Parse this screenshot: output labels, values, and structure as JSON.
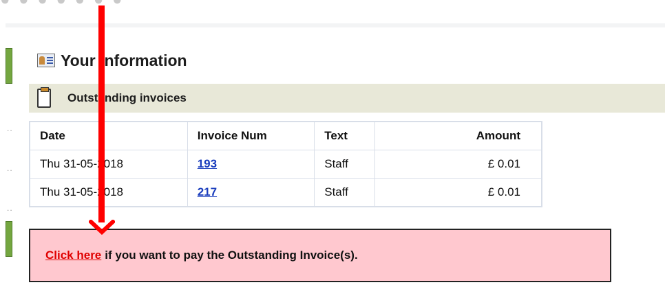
{
  "info_section": {
    "title": "Your Information",
    "icon": "id-card-icon"
  },
  "invoices_panel": {
    "title": "Outstanding invoices",
    "icon": "document-icon",
    "columns": [
      "Date",
      "Invoice Num",
      "Text",
      "Amount"
    ],
    "rows": [
      {
        "date": "Thu 31-05-2018",
        "invoice_num": "193",
        "text": "Staff",
        "amount": "£ 0.01"
      },
      {
        "date": "Thu 31-05-2018",
        "invoice_num": "217",
        "text": "Staff",
        "amount": "£ 0.01"
      }
    ]
  },
  "pay_notice": {
    "link_text": "Click here",
    "message": "if you want to pay the Outstanding Invoice(s).",
    "background": "#ffc8cf",
    "link_color": "#e00000"
  },
  "annotation": {
    "type": "red-arrow-down",
    "color": "#ff0000"
  },
  "sidebar": {
    "dots": [
      "..",
      "..",
      ".."
    ]
  }
}
